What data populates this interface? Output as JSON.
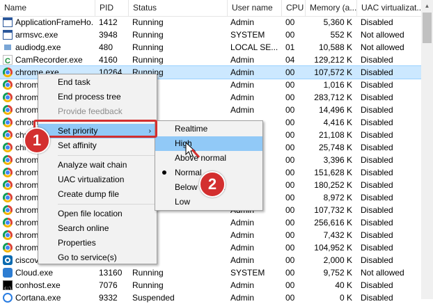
{
  "columns": [
    "Name",
    "PID",
    "Status",
    "User name",
    "CPU",
    "Memory (a...",
    "UAC virtualizat..."
  ],
  "rows": [
    {
      "name": "ApplicationFrameHo...",
      "pid": "1412",
      "status": "Running",
      "user": "Admin",
      "cpu": "00",
      "mem": "5,360 K",
      "uac": "Disabled",
      "icon": "app-frame-icon"
    },
    {
      "name": "armsvc.exe",
      "pid": "3948",
      "status": "Running",
      "user": "SYSTEM",
      "cpu": "00",
      "mem": "552 K",
      "uac": "Not allowed",
      "icon": "window-icon"
    },
    {
      "name": "audiodg.exe",
      "pid": "480",
      "status": "Running",
      "user": "LOCAL SE...",
      "cpu": "01",
      "mem": "10,588 K",
      "uac": "Not allowed",
      "icon": "audio-icon"
    },
    {
      "name": "CamRecorder.exe",
      "pid": "4160",
      "status": "Running",
      "user": "Admin",
      "cpu": "04",
      "mem": "129,212 K",
      "uac": "Disabled",
      "icon": "cam-icon"
    },
    {
      "name": "chrome.exe",
      "pid": "10264",
      "status": "Running",
      "user": "Admin",
      "cpu": "00",
      "mem": "107,572 K",
      "uac": "Disabled",
      "icon": "chrome-icon",
      "selected": true
    },
    {
      "name": "chrom",
      "pid": "",
      "status": "",
      "user": "Admin",
      "cpu": "00",
      "mem": "1,016 K",
      "uac": "Disabled",
      "icon": "chrome-icon"
    },
    {
      "name": "chrom",
      "pid": "",
      "status": "",
      "user": "Admin",
      "cpu": "00",
      "mem": "283,712 K",
      "uac": "Disabled",
      "icon": "chrome-icon"
    },
    {
      "name": "chrom",
      "pid": "",
      "status": "",
      "user": "Admin",
      "cpu": "00",
      "mem": "14,496 K",
      "uac": "Disabled",
      "icon": "chrome-icon"
    },
    {
      "name": "chrom",
      "pid": "",
      "status": "",
      "user": "",
      "cpu": "00",
      "mem": "4,416 K",
      "uac": "Disabled",
      "icon": "chrome-icon"
    },
    {
      "name": "chrom",
      "pid": "",
      "status": "",
      "user": "",
      "cpu": "00",
      "mem": "21,108 K",
      "uac": "Disabled",
      "icon": "chrome-icon"
    },
    {
      "name": "chrom",
      "pid": "",
      "status": "",
      "user": "",
      "cpu": "00",
      "mem": "25,748 K",
      "uac": "Disabled",
      "icon": "chrome-icon"
    },
    {
      "name": "chrom",
      "pid": "",
      "status": "",
      "user": "",
      "cpu": "00",
      "mem": "3,396 K",
      "uac": "Disabled",
      "icon": "chrome-icon"
    },
    {
      "name": "chrom",
      "pid": "",
      "status": "",
      "user": "",
      "cpu": "00",
      "mem": "151,628 K",
      "uac": "Disabled",
      "icon": "chrome-icon"
    },
    {
      "name": "chrom",
      "pid": "",
      "status": "",
      "user": "",
      "cpu": "00",
      "mem": "180,252 K",
      "uac": "Disabled",
      "icon": "chrome-icon"
    },
    {
      "name": "chrom",
      "pid": "",
      "status": "",
      "user": "",
      "cpu": "00",
      "mem": "8,972 K",
      "uac": "Disabled",
      "icon": "chrome-icon"
    },
    {
      "name": "chrom",
      "pid": "",
      "status": "",
      "user": "Admin",
      "cpu": "00",
      "mem": "107,732 K",
      "uac": "Disabled",
      "icon": "chrome-icon"
    },
    {
      "name": "chrom",
      "pid": "",
      "status": "",
      "user": "Admin",
      "cpu": "00",
      "mem": "256,616 K",
      "uac": "Disabled",
      "icon": "chrome-icon"
    },
    {
      "name": "chrom",
      "pid": "",
      "status": "",
      "user": "Admin",
      "cpu": "00",
      "mem": "7,432 K",
      "uac": "Disabled",
      "icon": "chrome-icon"
    },
    {
      "name": "chrom",
      "pid": "",
      "status": "",
      "user": "Admin",
      "cpu": "00",
      "mem": "104,952 K",
      "uac": "Disabled",
      "icon": "chrome-icon"
    },
    {
      "name": "ciscov",
      "pid": "",
      "status": "",
      "user": "Admin",
      "cpu": "00",
      "mem": "2,000 K",
      "uac": "Disabled",
      "icon": "cisco-icon"
    },
    {
      "name": "Cloud.exe",
      "pid": "13160",
      "status": "Running",
      "user": "SYSTEM",
      "cpu": "00",
      "mem": "9,752 K",
      "uac": "Not allowed",
      "icon": "cloud-icon"
    },
    {
      "name": "conhost.exe",
      "pid": "7076",
      "status": "Running",
      "user": "Admin",
      "cpu": "00",
      "mem": "40 K",
      "uac": "Disabled",
      "icon": "console-icon"
    },
    {
      "name": "Cortana.exe",
      "pid": "9332",
      "status": "Suspended",
      "user": "Admin",
      "cpu": "00",
      "mem": "0 K",
      "uac": "Disabled",
      "icon": "cortana-icon"
    }
  ],
  "context_menu": {
    "items": [
      {
        "label": "End task",
        "disabled": false
      },
      {
        "label": "End process tree",
        "disabled": false
      },
      {
        "label": "Provide feedback",
        "disabled": true
      },
      {
        "sep": true
      },
      {
        "label": "Set priority",
        "disabled": false,
        "submenu": true,
        "highlighted": true
      },
      {
        "label": "Set affinity",
        "disabled": false
      },
      {
        "sep": true
      },
      {
        "label": "Analyze wait chain",
        "disabled": false
      },
      {
        "label": "UAC virtualization",
        "disabled": false
      },
      {
        "label": "Create dump file",
        "disabled": false
      },
      {
        "sep": true
      },
      {
        "label": "Open file location",
        "disabled": false
      },
      {
        "label": "Search online",
        "disabled": false
      },
      {
        "label": "Properties",
        "disabled": false
      },
      {
        "label": "Go to service(s)",
        "disabled": false
      }
    ]
  },
  "priority_submenu": {
    "items": [
      {
        "label": "Realtime"
      },
      {
        "label": "High",
        "highlighted": true
      },
      {
        "label": "Above normal"
      },
      {
        "label": "Normal",
        "checked": true
      },
      {
        "label": "Below normal"
      },
      {
        "label": "Low"
      }
    ]
  },
  "annotations": {
    "step1": "1",
    "step2": "2"
  },
  "colors": {
    "selected_row": "#cce8ff",
    "menu_bg": "#f2f2f2",
    "highlight": "#91c9f7",
    "annotation_red": "#d32f2f"
  }
}
